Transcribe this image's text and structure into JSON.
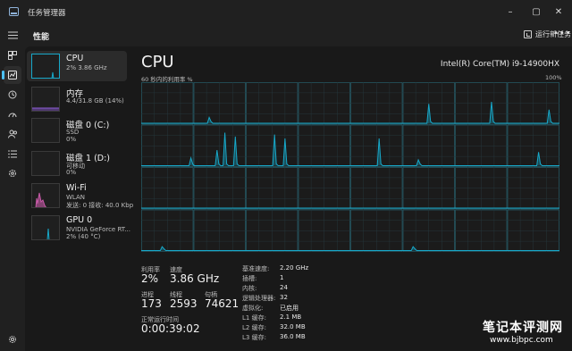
{
  "app": {
    "title": "任务管理器"
  },
  "window": {
    "minimize": "–",
    "maximize": "▢",
    "close": "✕"
  },
  "header": {
    "title": "性能",
    "run_task": "运行新任务",
    "more": "•••"
  },
  "resources": [
    {
      "name": "CPU",
      "line1": "2%  3.86 GHz",
      "line2": "",
      "color": "#17a8c9"
    },
    {
      "name": "内存",
      "line1": "4.4/31.8 GB (14%)",
      "line2": "",
      "color": "#8c5cd6"
    },
    {
      "name": "磁盘 0 (C:)",
      "line1": "SSD",
      "line2": "0%",
      "color": "#4caf50"
    },
    {
      "name": "磁盘 1 (D:)",
      "line1": "可移动",
      "line2": "0%",
      "color": "#4caf50"
    },
    {
      "name": "Wi-Fi",
      "line1": "WLAN",
      "line2": "发送: 0 接收: 40.0 Kbp",
      "color": "#c85aa8"
    },
    {
      "name": "GPU 0",
      "line1": "NVIDIA GeForce RT...",
      "line2": "2% (40 °C)",
      "color": "#17a8c9"
    }
  ],
  "cpu": {
    "title": "CPU",
    "model": "Intel(R) Core(TM) i9-14900HX",
    "graph_label": "60 秒内的利用率 %",
    "graph_max": "100%",
    "accent": "#17a8c9"
  },
  "stats": {
    "util_label": "利用率",
    "util": "2%",
    "speed_label": "速度",
    "speed": "3.86 GHz",
    "proc_label": "进程",
    "proc": "173",
    "threads_label": "线程",
    "threads": "2593",
    "handles_label": "句柄",
    "handles": "74621",
    "uptime_label": "正常运行时间",
    "uptime": "0:00:39:02"
  },
  "specs": [
    {
      "k": "基准速度:",
      "v": "2.20 GHz"
    },
    {
      "k": "插槽:",
      "v": "1"
    },
    {
      "k": "内核:",
      "v": "24"
    },
    {
      "k": "逻辑处理器:",
      "v": "32"
    },
    {
      "k": "虚拟化:",
      "v": "已启用"
    },
    {
      "k": "L1 缓存:",
      "v": "2.1 MB"
    },
    {
      "k": "L2 缓存:",
      "v": "32.0 MB"
    },
    {
      "k": "L3 缓存:",
      "v": "36.0 MB"
    }
  ],
  "watermark": {
    "line1": "笔记本评测网",
    "line2": "www.bjbpc.com"
  },
  "icons": [
    "hamburger-icon",
    "processes-icon",
    "performance-icon",
    "history-icon",
    "startup-icon",
    "users-icon",
    "details-icon",
    "services-icon",
    "settings-icon"
  ]
}
